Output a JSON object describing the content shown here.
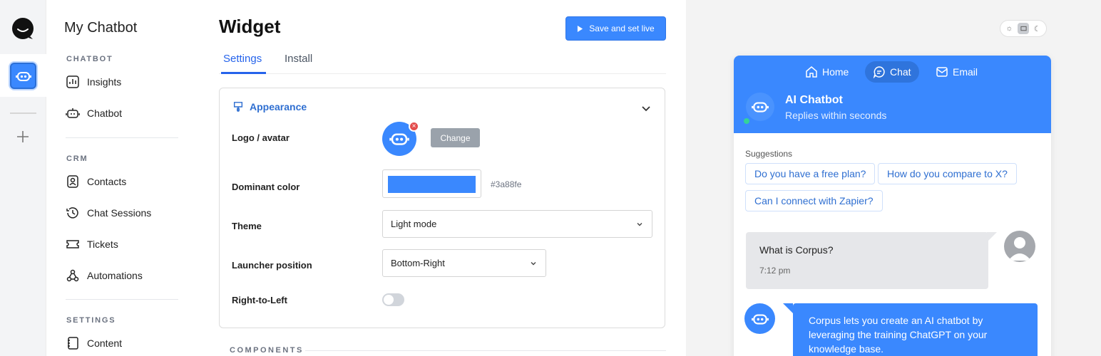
{
  "sidebar": {
    "title": "My Chatbot",
    "sections": [
      {
        "label": "CHATBOT",
        "items": [
          {
            "label": "Insights",
            "icon": "insights-icon"
          },
          {
            "label": "Chatbot",
            "icon": "bot-icon"
          }
        ]
      },
      {
        "label": "CRM",
        "items": [
          {
            "label": "Contacts",
            "icon": "contacts-icon"
          },
          {
            "label": "Chat Sessions",
            "icon": "history-icon"
          },
          {
            "label": "Tickets",
            "icon": "ticket-icon"
          },
          {
            "label": "Automations",
            "icon": "webhook-icon"
          }
        ]
      },
      {
        "label": "SETTINGS",
        "items": [
          {
            "label": "Content",
            "icon": "book-icon"
          }
        ]
      }
    ]
  },
  "main": {
    "title": "Widget",
    "save_label": "Save and set live",
    "tabs": [
      {
        "label": "Settings",
        "active": true
      },
      {
        "label": "Install",
        "active": false
      }
    ],
    "appearance": {
      "heading": "Appearance",
      "logo_label": "Logo / avatar",
      "change_label": "Change",
      "color_label": "Dominant color",
      "color_value": "#3a88fe",
      "theme_label": "Theme",
      "theme_value": "Light mode",
      "launcher_label": "Launcher position",
      "launcher_value": "Bottom-Right",
      "rtl_label": "Right-to-Left",
      "rtl_enabled": false
    },
    "components_label": "COMPONENTS"
  },
  "preview": {
    "nav": [
      {
        "label": "Home",
        "active": false
      },
      {
        "label": "Chat",
        "active": true
      },
      {
        "label": "Email",
        "active": false
      }
    ],
    "bot_name": "AI Chatbot",
    "bot_subtitle": "Replies within seconds",
    "suggestions_label": "Suggestions",
    "suggestions": [
      "Do you have a free plan?",
      "How do you compare to X?",
      "Can I connect with Zapier?"
    ],
    "user_message": "What is Corpus?",
    "user_time": "7:12 pm",
    "bot_message": "Corpus lets you create an AI chatbot by leveraging the training ChatGPT on your knowledge base.",
    "accent_color": "#3a88fe"
  }
}
